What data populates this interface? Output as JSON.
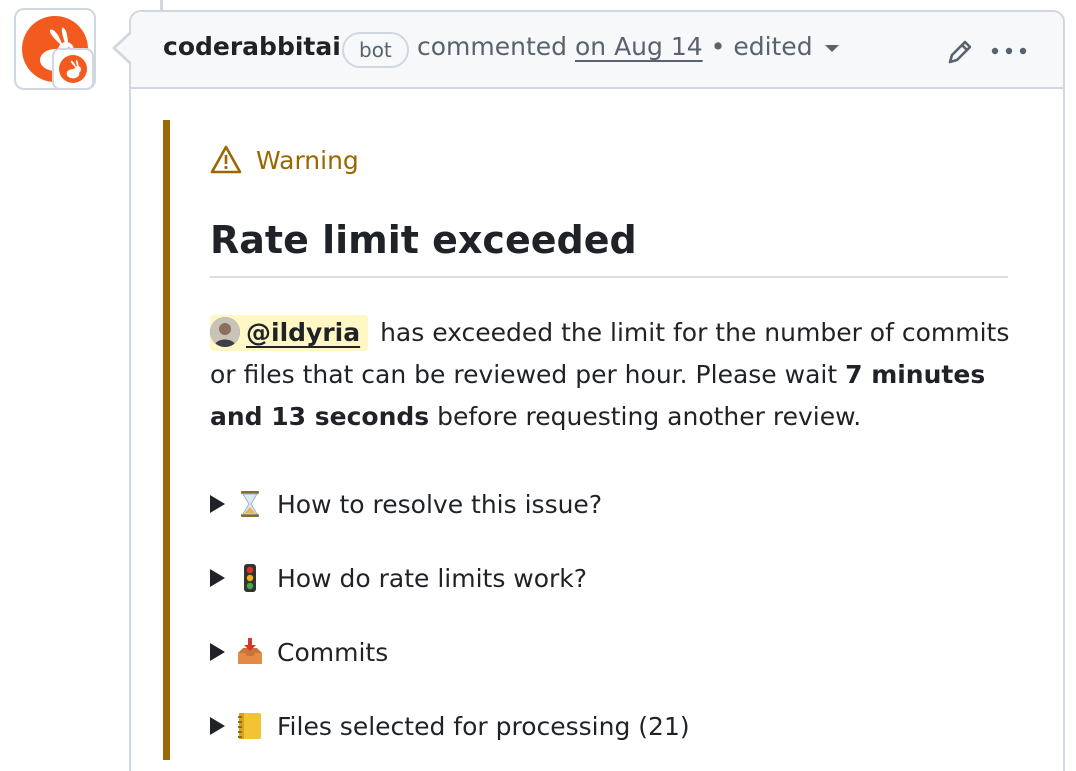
{
  "comment": {
    "author": "coderabbitai",
    "author_badge": "bot",
    "action": "commented",
    "date": "on Aug 14",
    "separator": "•",
    "edited_label": "edited"
  },
  "alert": {
    "type_label": "Warning",
    "heading": "Rate limit exceeded",
    "mention": "@ildyria",
    "body_text_1": "has exceeded the limit for the number of commits or files that can be reviewed per hour. Please wait",
    "wait_time": "7 minutes and 13 seconds",
    "body_text_2": "before requesting another review."
  },
  "details": [
    {
      "label": "How to resolve this issue?",
      "icon": "hourglass-icon"
    },
    {
      "label": "How do rate limits work?",
      "icon": "traffic-light-icon"
    },
    {
      "label": "Commits",
      "icon": "inbox-tray-icon"
    },
    {
      "label": "Files selected for processing (21)",
      "icon": "ledger-icon"
    }
  ],
  "colors": {
    "brand": "#f25a1f",
    "warning": "#9a6700",
    "mention_bg": "#fff8c5",
    "border": "#d0d7de",
    "muted_text": "#59636e"
  }
}
